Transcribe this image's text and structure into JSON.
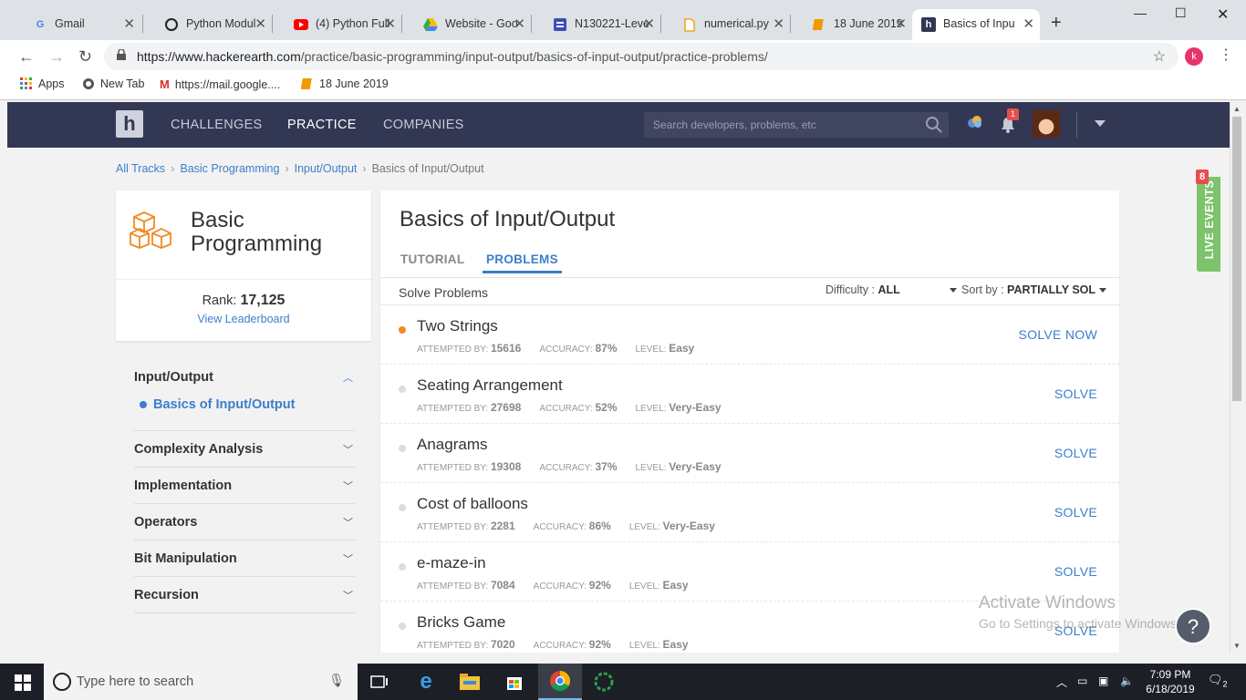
{
  "browser": {
    "tabs": [
      {
        "title": "Gmail",
        "icon": "G"
      },
      {
        "title": "Python Modul",
        "icon": "github"
      },
      {
        "title": "(4) Python Full",
        "icon": "youtube"
      },
      {
        "title": "Website - Goo",
        "icon": "drive"
      },
      {
        "title": "N130221-Leve",
        "icon": "forms"
      },
      {
        "title": "numerical.py",
        "icon": "file"
      },
      {
        "title": "18 June 2019",
        "icon": "note"
      },
      {
        "title": "Basics of Inpu",
        "icon": "H"
      }
    ],
    "url_domain": "https://www.hackerearth.com",
    "url_path": "/practice/basic-programming/input-output/basics-of-input-output/practice-problems/",
    "profile_initial": "k",
    "bookmarks": [
      "Apps",
      "New Tab",
      "https://mail.google....",
      "18 June 2019"
    ]
  },
  "site": {
    "logo": "h",
    "nav": [
      "CHALLENGES",
      "PRACTICE",
      "COMPANIES"
    ],
    "search_placeholder": "Search developers, problems, etc",
    "notification_count": "1"
  },
  "breadcrumb": [
    "All Tracks",
    "Basic Programming",
    "Input/Output",
    "Basics of Input/Output"
  ],
  "track": {
    "title_line1": "Basic",
    "title_line2": "Programming",
    "rank_label": "Rank:",
    "rank_value": "17,125",
    "leaderboard_link": "View Leaderboard"
  },
  "sidebar": {
    "sections": [
      {
        "label": "Input/Output",
        "expanded": true,
        "sub": "Basics of Input/Output"
      },
      {
        "label": "Complexity Analysis"
      },
      {
        "label": "Implementation"
      },
      {
        "label": "Operators"
      },
      {
        "label": "Bit Manipulation"
      },
      {
        "label": "Recursion"
      }
    ]
  },
  "main": {
    "title": "Basics of Input/Output",
    "tabs": [
      "TUTORIAL",
      "PROBLEMS"
    ],
    "solve_label": "Solve Problems",
    "difficulty_label": "Difficulty :",
    "difficulty_value": "ALL",
    "sort_label": "Sort by :",
    "sort_value": "PARTIALLY SOL",
    "attempted_label": "ATTEMPTED BY:",
    "accuracy_label": "ACCURACY:",
    "level_label": "LEVEL:",
    "problems": [
      {
        "name": "Two Strings",
        "attempted": "15616",
        "accuracy": "87%",
        "level": "Easy",
        "action": "SOLVE NOW",
        "status": "attempted"
      },
      {
        "name": "Seating Arrangement",
        "attempted": "27698",
        "accuracy": "52%",
        "level": "Very-Easy",
        "action": "SOLVE",
        "status": "new"
      },
      {
        "name": "Anagrams",
        "attempted": "19308",
        "accuracy": "37%",
        "level": "Very-Easy",
        "action": "SOLVE",
        "status": "new"
      },
      {
        "name": "Cost of balloons",
        "attempted": "2281",
        "accuracy": "86%",
        "level": "Very-Easy",
        "action": "SOLVE",
        "status": "new"
      },
      {
        "name": "e-maze-in",
        "attempted": "7084",
        "accuracy": "92%",
        "level": "Easy",
        "action": "SOLVE",
        "status": "new"
      },
      {
        "name": "Bricks Game",
        "attempted": "7020",
        "accuracy": "92%",
        "level": "Easy",
        "action": "SOLVE",
        "status": "new"
      }
    ]
  },
  "live_events": {
    "label": "LIVE EVENTS",
    "count": "8"
  },
  "watermark": {
    "line1": "Activate Windows",
    "line2": "Go to Settings to activate Windows."
  },
  "help_icon": "?",
  "taskbar": {
    "search_placeholder": "Type here to search",
    "time": "7:09 PM",
    "date": "6/18/2019",
    "notifications": "2"
  }
}
